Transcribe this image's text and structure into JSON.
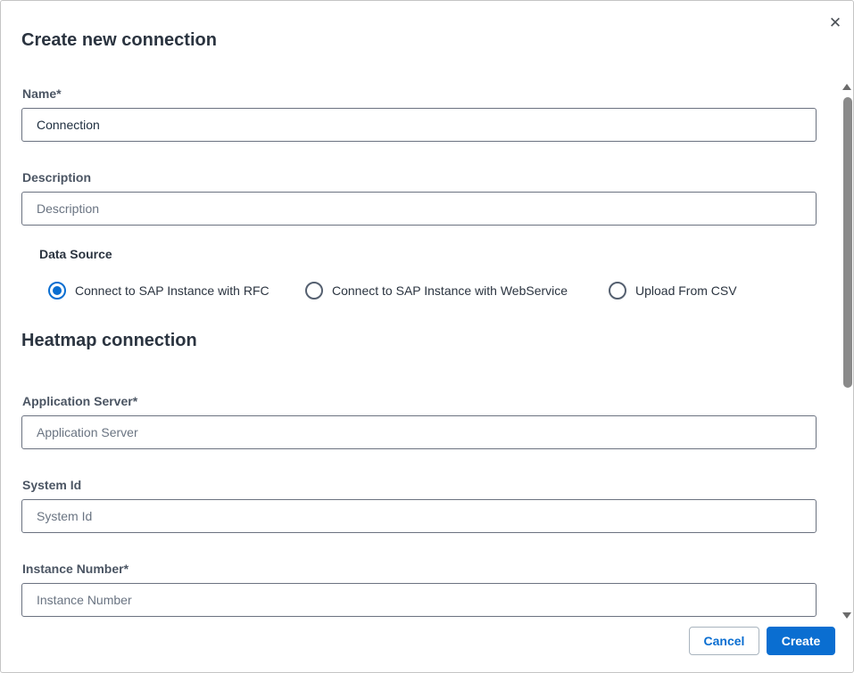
{
  "dialog": {
    "title": "Create new connection",
    "close_icon": "close-icon"
  },
  "fields": {
    "name": {
      "label": "Name*",
      "value": "Connection",
      "placeholder": ""
    },
    "description": {
      "label": "Description",
      "value": "",
      "placeholder": "Description"
    }
  },
  "data_source": {
    "label": "Data Source",
    "options": [
      {
        "label": "Connect to SAP Instance with RFC",
        "checked": true
      },
      {
        "label": "Connect to SAP Instance with WebService",
        "checked": false
      },
      {
        "label": "Upload From CSV",
        "checked": false
      }
    ]
  },
  "heatmap": {
    "title": "Heatmap connection",
    "fields": {
      "application_server": {
        "label": "Application Server*",
        "placeholder": "Application Server"
      },
      "system_id": {
        "label": "System Id",
        "placeholder": "System Id"
      },
      "instance_number": {
        "label": "Instance Number*",
        "placeholder": "Instance Number"
      }
    }
  },
  "footer": {
    "cancel_label": "Cancel",
    "create_label": "Create"
  },
  "colors": {
    "accent": "#0a6ed1",
    "text": "#2b3440",
    "border": "#6b7280"
  }
}
